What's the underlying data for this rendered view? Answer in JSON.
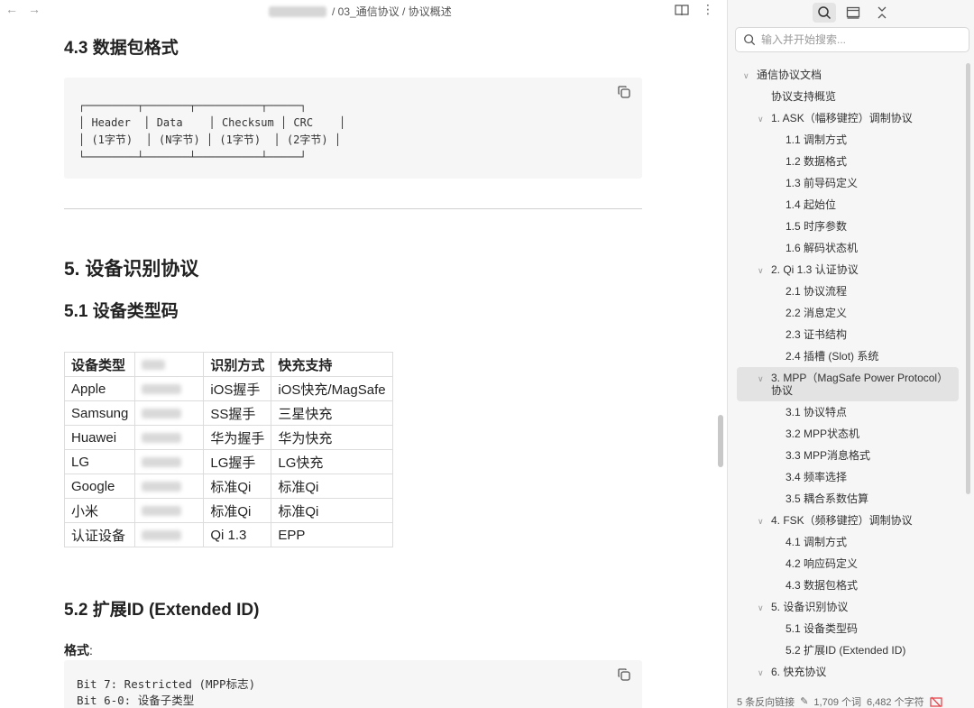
{
  "topbar": {
    "back": "←",
    "forward": "→",
    "breadcrumb": "/ 03_通信协议 / 协议概述"
  },
  "doc": {
    "h43": "4.3 数据包格式",
    "packet_ascii": "┌────────┬───────┬──────────┬─────┐\n│ Header  │ Data    │ Checksum │ CRC    │\n│ (1字节)  │ (N字节) │ (1字节)  │ (2字节) │\n└────────┴───────┴──────────┴─────┘",
    "h5": "5. 设备识别协议",
    "h51": "5.1 设备类型码",
    "table": {
      "headers": [
        "设备类型",
        "",
        "识别方式",
        "快充支持"
      ],
      "rows": [
        [
          "Apple",
          "",
          "iOS握手",
          "iOS快充/MagSafe"
        ],
        [
          "Samsung",
          "",
          "SS握手",
          "三星快充"
        ],
        [
          "Huawei",
          "",
          "华为握手",
          "华为快充"
        ],
        [
          "LG",
          "",
          "LG握手",
          "LG快充"
        ],
        [
          "Google",
          "",
          "标准Qi",
          "标准Qi"
        ],
        [
          "小米",
          "",
          "标准Qi",
          "标准Qi"
        ],
        [
          "认证设备",
          "",
          "Qi 1.3",
          "EPP"
        ]
      ]
    },
    "h52": "5.2 扩展ID (Extended ID)",
    "format_label": "格式",
    "format_colon": ":",
    "bits": "Bit 7: Restricted (MPP标志)\nBit 6-0: 设备子类型"
  },
  "sidebar": {
    "search_placeholder": "输入并开始搜索...",
    "outline": [
      {
        "label": "通信协议文档",
        "level": 0,
        "chevron": true
      },
      {
        "label": "协议支持概览",
        "level": 1,
        "chevron": false
      },
      {
        "label": "1. ASK（幅移键控）调制协议",
        "level": 1,
        "chevron": true
      },
      {
        "label": "1.1 调制方式",
        "level": 2
      },
      {
        "label": "1.2 数据格式",
        "level": 2
      },
      {
        "label": "1.3 前导码定义",
        "level": 2
      },
      {
        "label": "1.4 起始位",
        "level": 2
      },
      {
        "label": "1.5 时序参数",
        "level": 2
      },
      {
        "label": "1.6 解码状态机",
        "level": 2
      },
      {
        "label": "2. Qi 1.3 认证协议",
        "level": 1,
        "chevron": true
      },
      {
        "label": "2.1 协议流程",
        "level": 2
      },
      {
        "label": "2.2 消息定义",
        "level": 2
      },
      {
        "label": "2.3 证书结构",
        "level": 2
      },
      {
        "label": "2.4 插槽 (Slot) 系统",
        "level": 2
      },
      {
        "label": "3. MPP（MagSafe Power Protocol）协议",
        "level": 1,
        "chevron": true,
        "active": true
      },
      {
        "label": "3.1 协议特点",
        "level": 2
      },
      {
        "label": "3.2 MPP状态机",
        "level": 2
      },
      {
        "label": "3.3 MPP消息格式",
        "level": 2
      },
      {
        "label": "3.4 频率选择",
        "level": 2
      },
      {
        "label": "3.5 耦合系数估算",
        "level": 2
      },
      {
        "label": "4. FSK（频移键控）调制协议",
        "level": 1,
        "chevron": true
      },
      {
        "label": "4.1 调制方式",
        "level": 2
      },
      {
        "label": "4.2 响应码定义",
        "level": 2
      },
      {
        "label": "4.3 数据包格式",
        "level": 2
      },
      {
        "label": "5. 设备识别协议",
        "level": 1,
        "chevron": true
      },
      {
        "label": "5.1 设备类型码",
        "level": 2
      },
      {
        "label": "5.2 扩展ID (Extended ID)",
        "level": 2
      },
      {
        "label": "6. 快充协议",
        "level": 1,
        "chevron": true
      }
    ],
    "status": {
      "backlinks": "5 条反向链接",
      "words": "1,709 个词",
      "chars": "6,482 个字符"
    }
  },
  "colors": {
    "accent_red": "#e5484d",
    "active_bg": "#e3e3e3"
  }
}
